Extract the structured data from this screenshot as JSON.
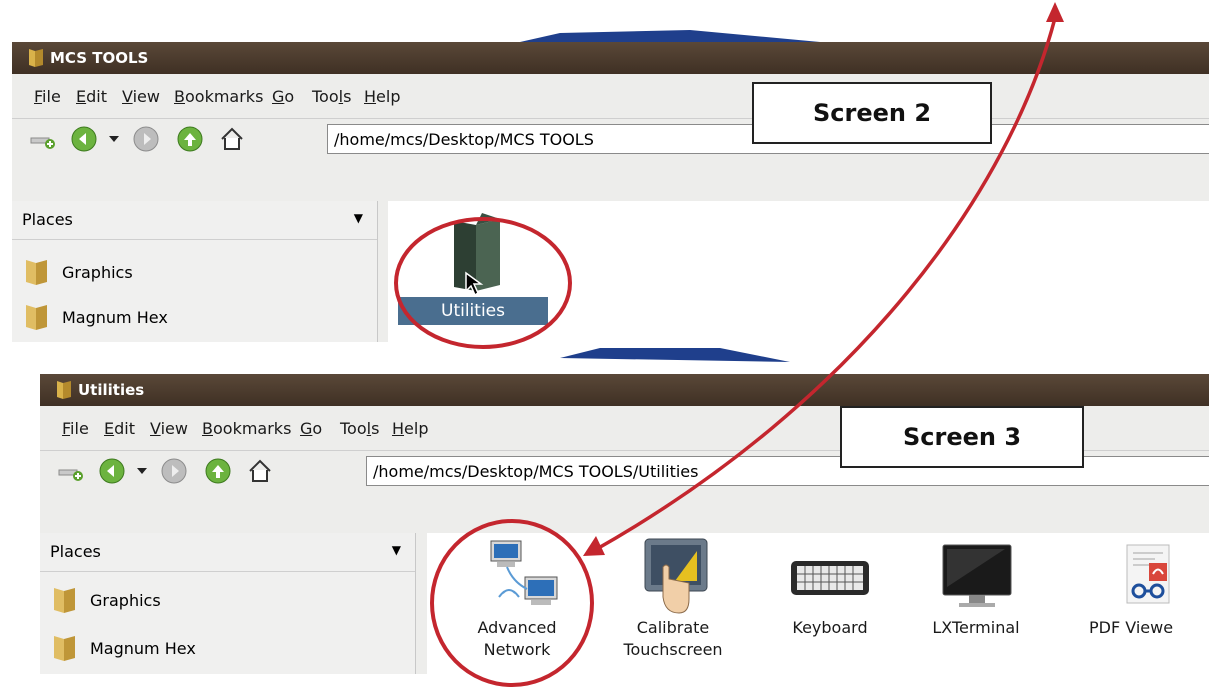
{
  "screen2": {
    "title": "MCS TOOLS",
    "menu": {
      "file": "File",
      "edit": "Edit",
      "view": "View",
      "bookmarks": "Bookmarks",
      "go": "Go",
      "tools": "Tools",
      "help": "Help"
    },
    "address": "/home/mcs/Desktop/MCS TOOLS",
    "sidebar": {
      "header": "Places",
      "items": [
        {
          "label": "Graphics"
        },
        {
          "label": "Magnum Hex"
        }
      ]
    },
    "files": [
      {
        "label": "Utilities",
        "icon": "folder-icon",
        "selected": true
      }
    ],
    "callout": "Screen 2"
  },
  "screen3": {
    "title": "Utilities",
    "menu": {
      "file": "File",
      "edit": "Edit",
      "view": "View",
      "bookmarks": "Bookmarks",
      "go": "Go",
      "tools": "Tools",
      "help": "Help"
    },
    "address": "/home/mcs/Desktop/MCS TOOLS/Utilities",
    "sidebar": {
      "header": "Places",
      "items": [
        {
          "label": "Graphics"
        },
        {
          "label": "Magnum Hex"
        }
      ]
    },
    "apps": [
      {
        "line1": "Advanced",
        "line2": "Network",
        "icon": "network-computers-icon"
      },
      {
        "line1": "Calibrate",
        "line2": "Touchscreen",
        "icon": "touchscreen-icon"
      },
      {
        "line1": "Keyboard",
        "line2": "",
        "icon": "keyboard-icon"
      },
      {
        "line1": "LXTerminal",
        "line2": "",
        "icon": "terminal-monitor-icon"
      },
      {
        "line1": "PDF Viewe",
        "line2": "",
        "icon": "pdf-viewer-icon"
      }
    ],
    "callout": "Screen 3"
  },
  "colors": {
    "annotation_red": "#c4262e",
    "titlebar_brown": "#4a392b",
    "selection_blue": "#4a6e8f"
  }
}
